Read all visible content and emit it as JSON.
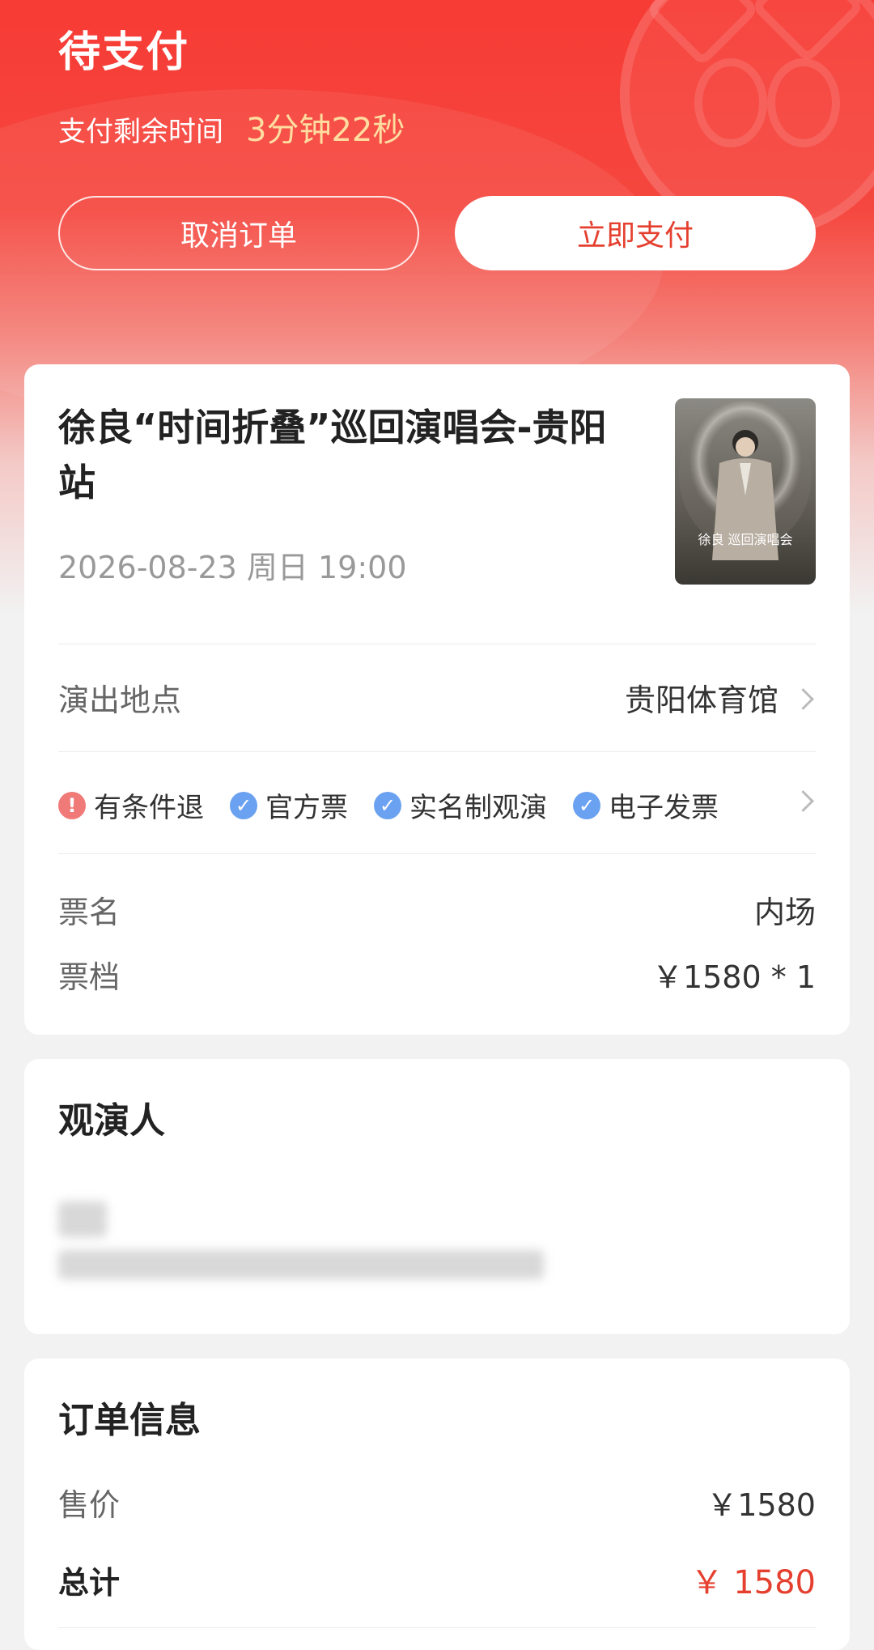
{
  "header": {
    "status_title": "待支付",
    "timer_label": "支付剩余时间",
    "timer_value": "3分钟22秒",
    "cancel_label": "取消订单",
    "pay_label": "立即支付"
  },
  "event": {
    "title": "徐良“时间折叠”巡回演唱会-贵阳站",
    "datetime": "2026-08-23 周日 19:00",
    "poster_text": "徐良 巡回演唱会",
    "venue_label": "演出地点",
    "venue_value": "贵阳体育馆",
    "tags": [
      {
        "icon": "warning-icon",
        "text": "有条件退"
      },
      {
        "icon": "check-icon",
        "text": "官方票"
      },
      {
        "icon": "check-icon",
        "text": "实名制观演"
      },
      {
        "icon": "check-icon",
        "text": "电子发票"
      }
    ],
    "ticket_name_label": "票名",
    "ticket_name_value": "内场",
    "ticket_tier_label": "票档",
    "ticket_tier_value": "￥1580 * 1"
  },
  "attendee": {
    "title": "观演人"
  },
  "order": {
    "title": "订单信息",
    "price_label": "售价",
    "price_value": "￥1580",
    "total_label": "总计",
    "total_value": "￥ 1580"
  },
  "colors": {
    "accent": "#e5402f",
    "timer": "#ffdca0",
    "check": "#6aa1f0",
    "warn": "#f07a78"
  }
}
